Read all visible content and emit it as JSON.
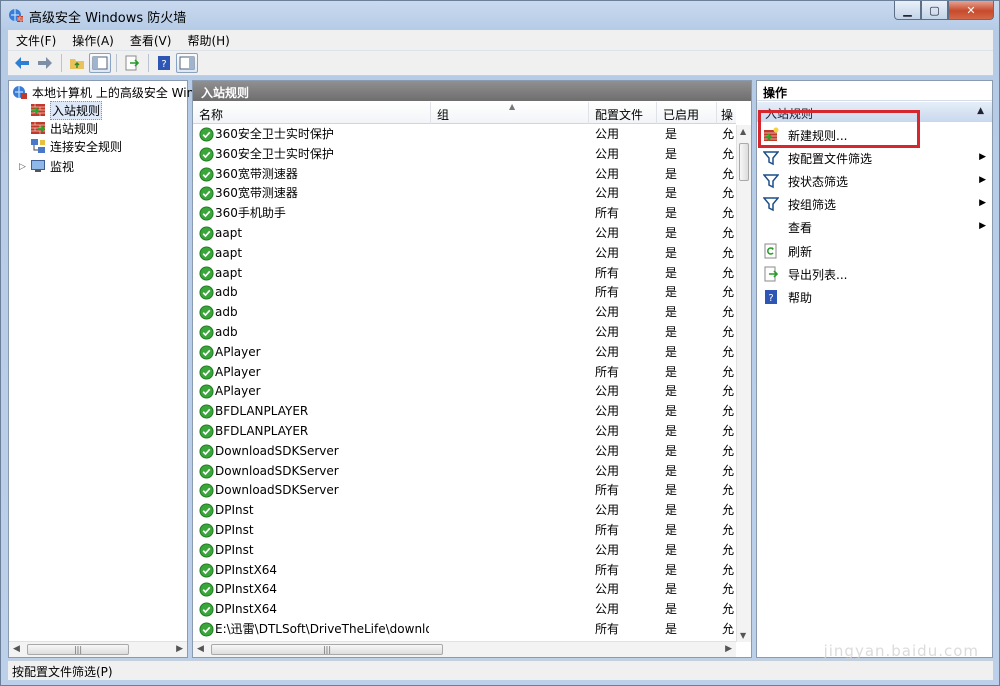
{
  "window": {
    "title": "高级安全 Windows 防火墙"
  },
  "menu": [
    "文件(F)",
    "操作(A)",
    "查看(V)",
    "帮助(H)"
  ],
  "tree": {
    "root": "本地计算机 上的高级安全 Win",
    "items": [
      "入站规则",
      "出站规则",
      "连接安全规则",
      "监视"
    ]
  },
  "center": {
    "title": "入站规则",
    "columns": [
      "名称",
      "组",
      "配置文件",
      "已启用",
      "操"
    ],
    "rows": [
      {
        "name": "360安全卫士实时保护",
        "group": "",
        "profile": "公用",
        "enabled": "是",
        "action": "允"
      },
      {
        "name": "360安全卫士实时保护",
        "group": "",
        "profile": "公用",
        "enabled": "是",
        "action": "允"
      },
      {
        "name": "360宽带测速器",
        "group": "",
        "profile": "公用",
        "enabled": "是",
        "action": "允"
      },
      {
        "name": "360宽带测速器",
        "group": "",
        "profile": "公用",
        "enabled": "是",
        "action": "允"
      },
      {
        "name": "360手机助手",
        "group": "",
        "profile": "所有",
        "enabled": "是",
        "action": "允"
      },
      {
        "name": "aapt",
        "group": "",
        "profile": "公用",
        "enabled": "是",
        "action": "允"
      },
      {
        "name": "aapt",
        "group": "",
        "profile": "公用",
        "enabled": "是",
        "action": "允"
      },
      {
        "name": "aapt",
        "group": "",
        "profile": "所有",
        "enabled": "是",
        "action": "允"
      },
      {
        "name": "adb",
        "group": "",
        "profile": "所有",
        "enabled": "是",
        "action": "允"
      },
      {
        "name": "adb",
        "group": "",
        "profile": "公用",
        "enabled": "是",
        "action": "允"
      },
      {
        "name": "adb",
        "group": "",
        "profile": "公用",
        "enabled": "是",
        "action": "允"
      },
      {
        "name": "APlayer",
        "group": "",
        "profile": "公用",
        "enabled": "是",
        "action": "允"
      },
      {
        "name": "APlayer",
        "group": "",
        "profile": "所有",
        "enabled": "是",
        "action": "允"
      },
      {
        "name": "APlayer",
        "group": "",
        "profile": "公用",
        "enabled": "是",
        "action": "允"
      },
      {
        "name": "BFDLANPLAYER",
        "group": "",
        "profile": "公用",
        "enabled": "是",
        "action": "允"
      },
      {
        "name": "BFDLANPLAYER",
        "group": "",
        "profile": "公用",
        "enabled": "是",
        "action": "允"
      },
      {
        "name": "DownloadSDKServer",
        "group": "",
        "profile": "公用",
        "enabled": "是",
        "action": "允"
      },
      {
        "name": "DownloadSDKServer",
        "group": "",
        "profile": "公用",
        "enabled": "是",
        "action": "允"
      },
      {
        "name": "DownloadSDKServer",
        "group": "",
        "profile": "所有",
        "enabled": "是",
        "action": "允"
      },
      {
        "name": "DPInst",
        "group": "",
        "profile": "公用",
        "enabled": "是",
        "action": "允"
      },
      {
        "name": "DPInst",
        "group": "",
        "profile": "所有",
        "enabled": "是",
        "action": "允"
      },
      {
        "name": "DPInst",
        "group": "",
        "profile": "公用",
        "enabled": "是",
        "action": "允"
      },
      {
        "name": "DPInstX64",
        "group": "",
        "profile": "所有",
        "enabled": "是",
        "action": "允"
      },
      {
        "name": "DPInstX64",
        "group": "",
        "profile": "公用",
        "enabled": "是",
        "action": "允"
      },
      {
        "name": "DPInstX64",
        "group": "",
        "profile": "公用",
        "enabled": "是",
        "action": "允"
      },
      {
        "name": "E:\\迅雷\\DTLSoft\\DriveTheLife\\downlo...",
        "group": "",
        "profile": "所有",
        "enabled": "是",
        "action": "允"
      }
    ]
  },
  "actions": {
    "title": "操作",
    "section": "入站规则",
    "items": [
      "新建规则...",
      "按配置文件筛选",
      "按状态筛选",
      "按组筛选",
      "查看",
      "刷新",
      "导出列表...",
      "帮助"
    ]
  },
  "statusbar": {
    "text": "按配置文件筛选(P)"
  },
  "watermark": "jingyan.baidu.com",
  "colors": {
    "highlight": "#d6262e",
    "check": "#3aa53a",
    "header": "#7b7b7b"
  }
}
